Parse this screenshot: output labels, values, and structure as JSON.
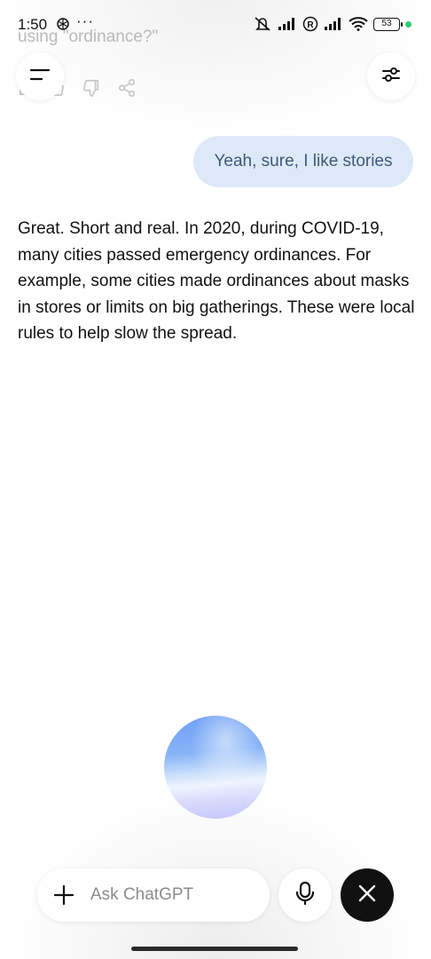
{
  "status_bar": {
    "time": "1:50",
    "more_dots": "···",
    "battery": "53",
    "icons": [
      "chatgpt-app-icon",
      "muted-vibrate-icon",
      "signal-icon",
      "registered-icon",
      "signal-icon",
      "wifi-icon",
      "battery-icon"
    ]
  },
  "previous_message": {
    "trailing_text": "using \"ordinance?\""
  },
  "header": {
    "menu_icon": "menu-icon",
    "settings_icon": "sliders-icon"
  },
  "conversation": {
    "user_message": "Yeah, sure, I like stories",
    "assistant_message": "Great. Short and real. In 2020, during COVID-19, many cities passed emergency ordinances. For example, some cities made ordinances about masks in stores or limits on big gatherings. These were local rules to help slow the spread."
  },
  "composer": {
    "placeholder": "Ask ChatGPT",
    "add_icon": "plus-icon",
    "mic_icon": "microphone-icon",
    "close_icon": "close-icon"
  },
  "colors": {
    "user_bubble": "#dde9f8",
    "user_text": "#3f5a7a",
    "close_button": "#111111",
    "orb_top": "#6f9ef5",
    "orb_bottom": "#c4c6fb"
  }
}
